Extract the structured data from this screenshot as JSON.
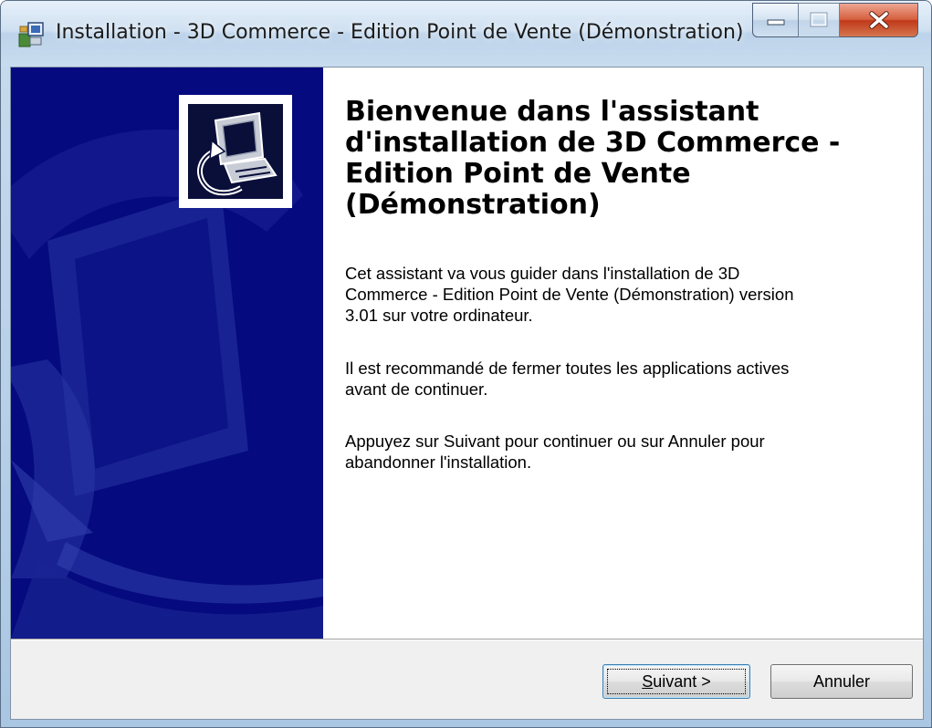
{
  "window": {
    "title": "Installation - 3D Commerce - Edition Point de Vente (Démonstration)"
  },
  "icons": {
    "app": "installer-app-icon",
    "logo": "computer-install-icon",
    "minimize": "minimize-icon",
    "maximize": "maximize-icon",
    "close": "close-icon"
  },
  "colors": {
    "side_panel": "#050a7e",
    "close_button": "#c0391a",
    "footer": "#f0f0f0"
  },
  "content": {
    "title": "Bienvenue dans l'assistant\nd'installation de 3D Commerce -\nEdition Point de Vente\n(Démonstration)",
    "paragraph1": "Cet assistant va vous guider dans l'installation de 3D\nCommerce - Edition Point de Vente (Démonstration) version\n3.01 sur votre ordinateur.",
    "paragraph2": "Il est recommandé de fermer toutes les applications actives\navant de continuer.",
    "paragraph3": "Appuyez sur Suivant pour continuer ou sur Annuler pour\nabandonner l'installation."
  },
  "buttons": {
    "next_mnemonic": "S",
    "next_rest": "uivant >",
    "cancel": "Annuler"
  }
}
